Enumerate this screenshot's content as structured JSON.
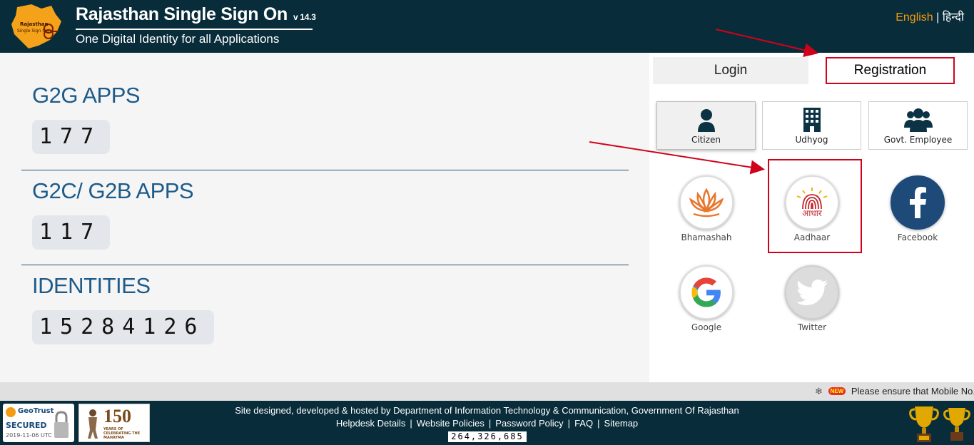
{
  "header": {
    "title": "Rajasthan Single Sign On",
    "version": "v 14.3",
    "subtitle": "One Digital Identity for all Applications",
    "lang_english": "English",
    "lang_separator": "|",
    "lang_hindi": "हिन्दी",
    "logo_text_top": "Rajasthan",
    "logo_text_bottom": "Single Sign On"
  },
  "stats": [
    {
      "title": "G2G APPS",
      "value": "177"
    },
    {
      "title": "G2C/ G2B APPS",
      "value": "117"
    },
    {
      "title": "IDENTITIES",
      "value": "15284126"
    }
  ],
  "tabs": {
    "login": "Login",
    "registration": "Registration"
  },
  "user_types": [
    {
      "label": "Citizen",
      "icon": "user-icon"
    },
    {
      "label": "Udhyog",
      "icon": "building-icon"
    },
    {
      "label": "Govt. Employee",
      "icon": "group-icon"
    }
  ],
  "register_options": [
    {
      "label": "Bhamashah",
      "icon": "lotus-icon"
    },
    {
      "label": "Aadhaar",
      "icon": "aadhaar-icon",
      "icon_text": "आधार"
    },
    {
      "label": "Facebook",
      "icon": "facebook-icon"
    },
    {
      "label": "Google",
      "icon": "google-icon"
    },
    {
      "label": "Twitter",
      "icon": "twitter-icon"
    }
  ],
  "ticker": {
    "new_badge": "NEW",
    "message": "Please ensure that Mobile No."
  },
  "footer": {
    "credit": "Site designed, developed & hosted by Department of Information Technology & Communication, Government Of Rajasthan",
    "links": [
      "Helpdesk Details",
      "Website Policies",
      "Password Policy",
      "FAQ",
      "Sitemap"
    ],
    "visitor_count": "264,326,685",
    "geotrust_brand": "GeoTrust",
    "geotrust_status": "SECURED",
    "geotrust_date": "2019-11-06 UTC",
    "mahatma_number": "150",
    "mahatma_text": "YEARS OF CELEBRATING THE MAHATMA"
  },
  "colors": {
    "header_bg": "#082c3a",
    "stat_title": "#1d5b8a",
    "highlight_red": "#d0021b",
    "english_link": "#f39c12"
  }
}
